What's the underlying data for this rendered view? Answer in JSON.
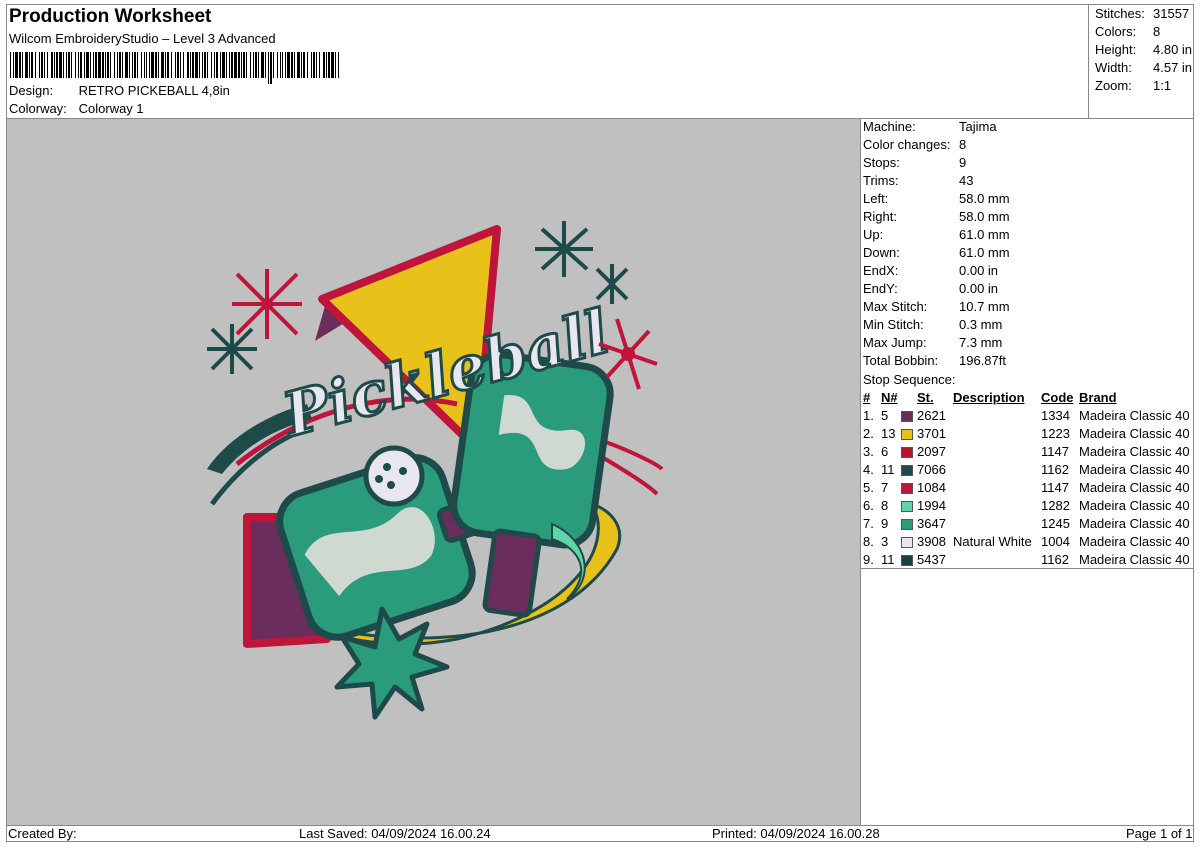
{
  "header": {
    "title": "Production Worksheet",
    "software": "Wilcom EmbroideryStudio – Level 3 Advanced",
    "design_label": "Design:",
    "design_value": "RETRO PICKEBALL 4,8in",
    "colorway_label": "Colorway:",
    "colorway_value": "Colorway 1"
  },
  "summary": [
    {
      "label": "Stitches:",
      "value": "31557"
    },
    {
      "label": "Colors:",
      "value": "8"
    },
    {
      "label": "Height:",
      "value": "4.80 in"
    },
    {
      "label": "Width:",
      "value": "4.57 in"
    },
    {
      "label": "Zoom:",
      "value": "1:1"
    }
  ],
  "properties": [
    {
      "label": "Machine:",
      "value": "Tajima"
    },
    {
      "label": "Color changes:",
      "value": "8"
    },
    {
      "label": "Stops:",
      "value": "9"
    },
    {
      "label": "Trims:",
      "value": "43"
    },
    {
      "label": "Left:",
      "value": "58.0 mm"
    },
    {
      "label": "Right:",
      "value": "58.0 mm"
    },
    {
      "label": "Up:",
      "value": "61.0 mm"
    },
    {
      "label": "Down:",
      "value": "61.0 mm"
    },
    {
      "label": "EndX:",
      "value": "0.00 in"
    },
    {
      "label": "EndY:",
      "value": "0.00 in"
    },
    {
      "label": "Max Stitch:",
      "value": "10.7 mm"
    },
    {
      "label": "Min Stitch:",
      "value": "0.3 mm"
    },
    {
      "label": "Max Jump:",
      "value": "7.3 mm"
    },
    {
      "label": "Total Bobbin:",
      "value": "196.87ft"
    }
  ],
  "stop_sequence": {
    "title": "Stop Sequence:",
    "headers": {
      "num": "#",
      "n": "N#",
      "st": "St.",
      "desc": "Description",
      "code": "Code",
      "brand": "Brand"
    },
    "rows": [
      {
        "num": "1.",
        "n": "5",
        "color": "#6b2d5c",
        "st": "2621",
        "desc": "",
        "code": "1334",
        "brand": "Madeira Classic 40"
      },
      {
        "num": "2.",
        "n": "13",
        "color": "#e8c21a",
        "st": "3701",
        "desc": "",
        "code": "1223",
        "brand": "Madeira Classic 40"
      },
      {
        "num": "3.",
        "n": "6",
        "color": "#b5152b",
        "st": "2097",
        "desc": "",
        "code": "1147",
        "brand": "Madeira Classic 40"
      },
      {
        "num": "4.",
        "n": "11",
        "color": "#1f4a4a",
        "st": "7066",
        "desc": "",
        "code": "1162",
        "brand": "Madeira Classic 40"
      },
      {
        "num": "5.",
        "n": "7",
        "color": "#c0153a",
        "st": "1084",
        "desc": "",
        "code": "1147",
        "brand": "Madeira Classic 40"
      },
      {
        "num": "6.",
        "n": "8",
        "color": "#5fd4a8",
        "st": "1994",
        "desc": "",
        "code": "1282",
        "brand": "Madeira Classic 40"
      },
      {
        "num": "7.",
        "n": "9",
        "color": "#2a9c7c",
        "st": "3647",
        "desc": "",
        "code": "1245",
        "brand": "Madeira Classic 40"
      },
      {
        "num": "8.",
        "n": "3",
        "color": "#e8e6ee",
        "st": "3908",
        "desc": "Natural White",
        "code": "1004",
        "brand": "Madeira Classic 40"
      },
      {
        "num": "9.",
        "n": "11",
        "color": "#1a3f3f",
        "st": "5437",
        "desc": "",
        "code": "1162",
        "brand": "Madeira Classic 40"
      }
    ]
  },
  "design_art": {
    "wordmark": "Pickleball"
  },
  "footer": {
    "created_by": "Created By:",
    "last_saved": "Last Saved: 04/09/2024 16.00.24",
    "printed": "Printed: 04/09/2024 16.00.28",
    "page": "Page 1 of 1"
  }
}
